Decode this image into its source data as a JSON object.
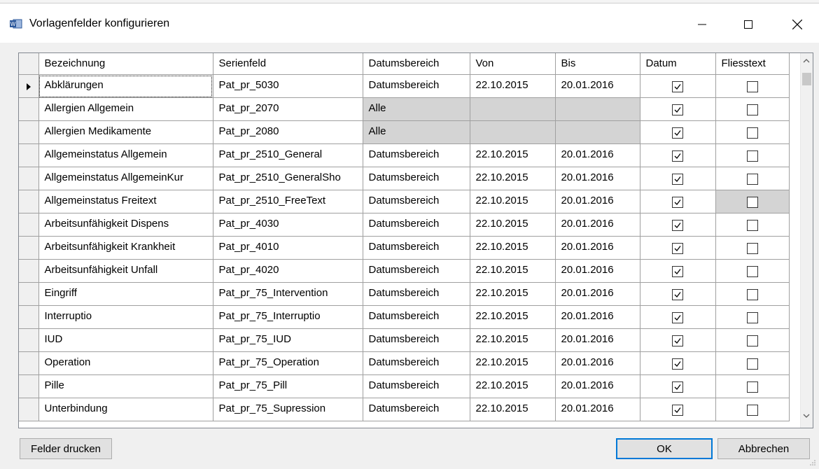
{
  "window": {
    "title": "Vorlagenfelder konfigurieren"
  },
  "columns": [
    "Bezeichnung",
    "Serienfeld",
    "Datumsbereich",
    "Von",
    "Bis",
    "Datum",
    "Fliesstext"
  ],
  "rows": [
    {
      "bezeichnung": "Abklärungen",
      "serienfeld": "Pat_pr_5030",
      "bereich": "Datumsbereich",
      "von": "22.10.2015",
      "bis": "20.01.2016",
      "datum": true,
      "fliesstext": false
    },
    {
      "bezeichnung": "Allergien Allgemein",
      "serienfeld": "Pat_pr_2070",
      "bereich": "Alle",
      "von": "",
      "bis": "",
      "datum": true,
      "fliesstext": false
    },
    {
      "bezeichnung": "Allergien Medikamente",
      "serienfeld": "Pat_pr_2080",
      "bereich": "Alle",
      "von": "",
      "bis": "",
      "datum": true,
      "fliesstext": false
    },
    {
      "bezeichnung": "Allgemeinstatus Allgemein",
      "serienfeld": "Pat_pr_2510_General",
      "bereich": "Datumsbereich",
      "von": "22.10.2015",
      "bis": "20.01.2016",
      "datum": true,
      "fliesstext": false
    },
    {
      "bezeichnung": "Allgemeinstatus AllgemeinKur",
      "serienfeld": "Pat_pr_2510_GeneralSho",
      "bereich": "Datumsbereich",
      "von": "22.10.2015",
      "bis": "20.01.2016",
      "datum": true,
      "fliesstext": false
    },
    {
      "bezeichnung": "Allgemeinstatus Freitext",
      "serienfeld": "Pat_pr_2510_FreeText",
      "bereich": "Datumsbereich",
      "von": "22.10.2015",
      "bis": "20.01.2016",
      "datum": true,
      "fliesstext": false
    },
    {
      "bezeichnung": "Arbeitsunfähigkeit Dispens",
      "serienfeld": "Pat_pr_4030",
      "bereich": "Datumsbereich",
      "von": "22.10.2015",
      "bis": "20.01.2016",
      "datum": true,
      "fliesstext": false
    },
    {
      "bezeichnung": "Arbeitsunfähigkeit Krankheit",
      "serienfeld": "Pat_pr_4010",
      "bereich": "Datumsbereich",
      "von": "22.10.2015",
      "bis": "20.01.2016",
      "datum": true,
      "fliesstext": false
    },
    {
      "bezeichnung": "Arbeitsunfähigkeit Unfall",
      "serienfeld": "Pat_pr_4020",
      "bereich": "Datumsbereich",
      "von": "22.10.2015",
      "bis": "20.01.2016",
      "datum": true,
      "fliesstext": false
    },
    {
      "bezeichnung": "Eingriff",
      "serienfeld": "Pat_pr_75_Intervention",
      "bereich": "Datumsbereich",
      "von": "22.10.2015",
      "bis": "20.01.2016",
      "datum": true,
      "fliesstext": false
    },
    {
      "bezeichnung": "Interruptio",
      "serienfeld": "Pat_pr_75_Interruptio",
      "bereich": "Datumsbereich",
      "von": "22.10.2015",
      "bis": "20.01.2016",
      "datum": true,
      "fliesstext": false
    },
    {
      "bezeichnung": "IUD",
      "serienfeld": "Pat_pr_75_IUD",
      "bereich": "Datumsbereich",
      "von": "22.10.2015",
      "bis": "20.01.2016",
      "datum": true,
      "fliesstext": false
    },
    {
      "bezeichnung": "Operation",
      "serienfeld": "Pat_pr_75_Operation",
      "bereich": "Datumsbereich",
      "von": "22.10.2015",
      "bis": "20.01.2016",
      "datum": true,
      "fliesstext": false
    },
    {
      "bezeichnung": "Pille",
      "serienfeld": "Pat_pr_75_Pill",
      "bereich": "Datumsbereich",
      "von": "22.10.2015",
      "bis": "20.01.2016",
      "datum": true,
      "fliesstext": false
    },
    {
      "bezeichnung": "Unterbindung",
      "serienfeld": "Pat_pr_75_Supression",
      "bereich": "Datumsbereich",
      "von": "22.10.2015",
      "bis": "20.01.2016",
      "datum": true,
      "fliesstext": false
    }
  ],
  "buttons": {
    "print": "Felder drucken",
    "ok": "OK",
    "cancel": "Abbrechen"
  },
  "colors": {
    "gray_cell": "#d4d4d4",
    "accent": "#0078d7"
  }
}
